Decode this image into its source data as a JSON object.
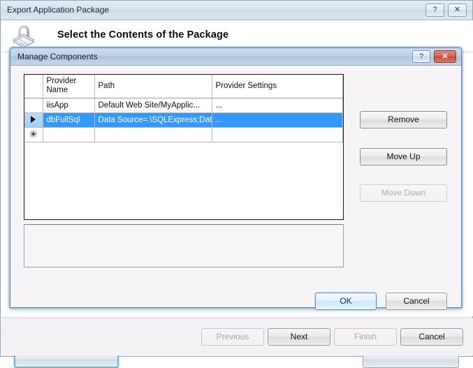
{
  "outer_window": {
    "title": "Export Application Package",
    "help_label": "?",
    "close_label": "✕",
    "header_title": "Select the Contents of the Package",
    "icon": "package-box-icon",
    "footer": {
      "previous_label": "Previous",
      "next_label": "Next",
      "finish_label": "Finish",
      "cancel_label": "Cancel",
      "previous_enabled": false,
      "next_enabled": true,
      "finish_enabled": false,
      "cancel_enabled": true
    },
    "occluded_buttons": {
      "left_label": "",
      "right_label": ""
    }
  },
  "modal": {
    "title": "Manage Components",
    "help_label": "?",
    "close_label": "✕",
    "grid": {
      "columns": [
        "",
        "Provider Name",
        "Path",
        "Provider Settings"
      ],
      "rows": [
        {
          "indicator": "",
          "provider_name": "iisApp",
          "path": "Default Web Site/MyApplic...",
          "provider_settings": "...",
          "selected": false
        },
        {
          "indicator": "▶",
          "provider_name": "dbFullSql",
          "path": "Data Source=.\\SQLExpress;Dat",
          "provider_settings": "...",
          "selected": true
        },
        {
          "indicator": "✳",
          "provider_name": "",
          "path": "",
          "provider_settings": "",
          "selected": false
        }
      ]
    },
    "description_panel_text": "",
    "side_buttons": [
      {
        "label": "Remove",
        "enabled": true
      },
      {
        "label": "Move Up",
        "enabled": true
      },
      {
        "label": "Move Down",
        "enabled": false
      }
    ],
    "footer": {
      "ok_label": "OK",
      "cancel_label": "Cancel",
      "ok_focused": true
    }
  },
  "colors": {
    "selection_blue": "#3399ff",
    "titlebar_active": "#b0c4dc",
    "close_red": "#c2503f",
    "window_bg": "#f3f1f4"
  }
}
